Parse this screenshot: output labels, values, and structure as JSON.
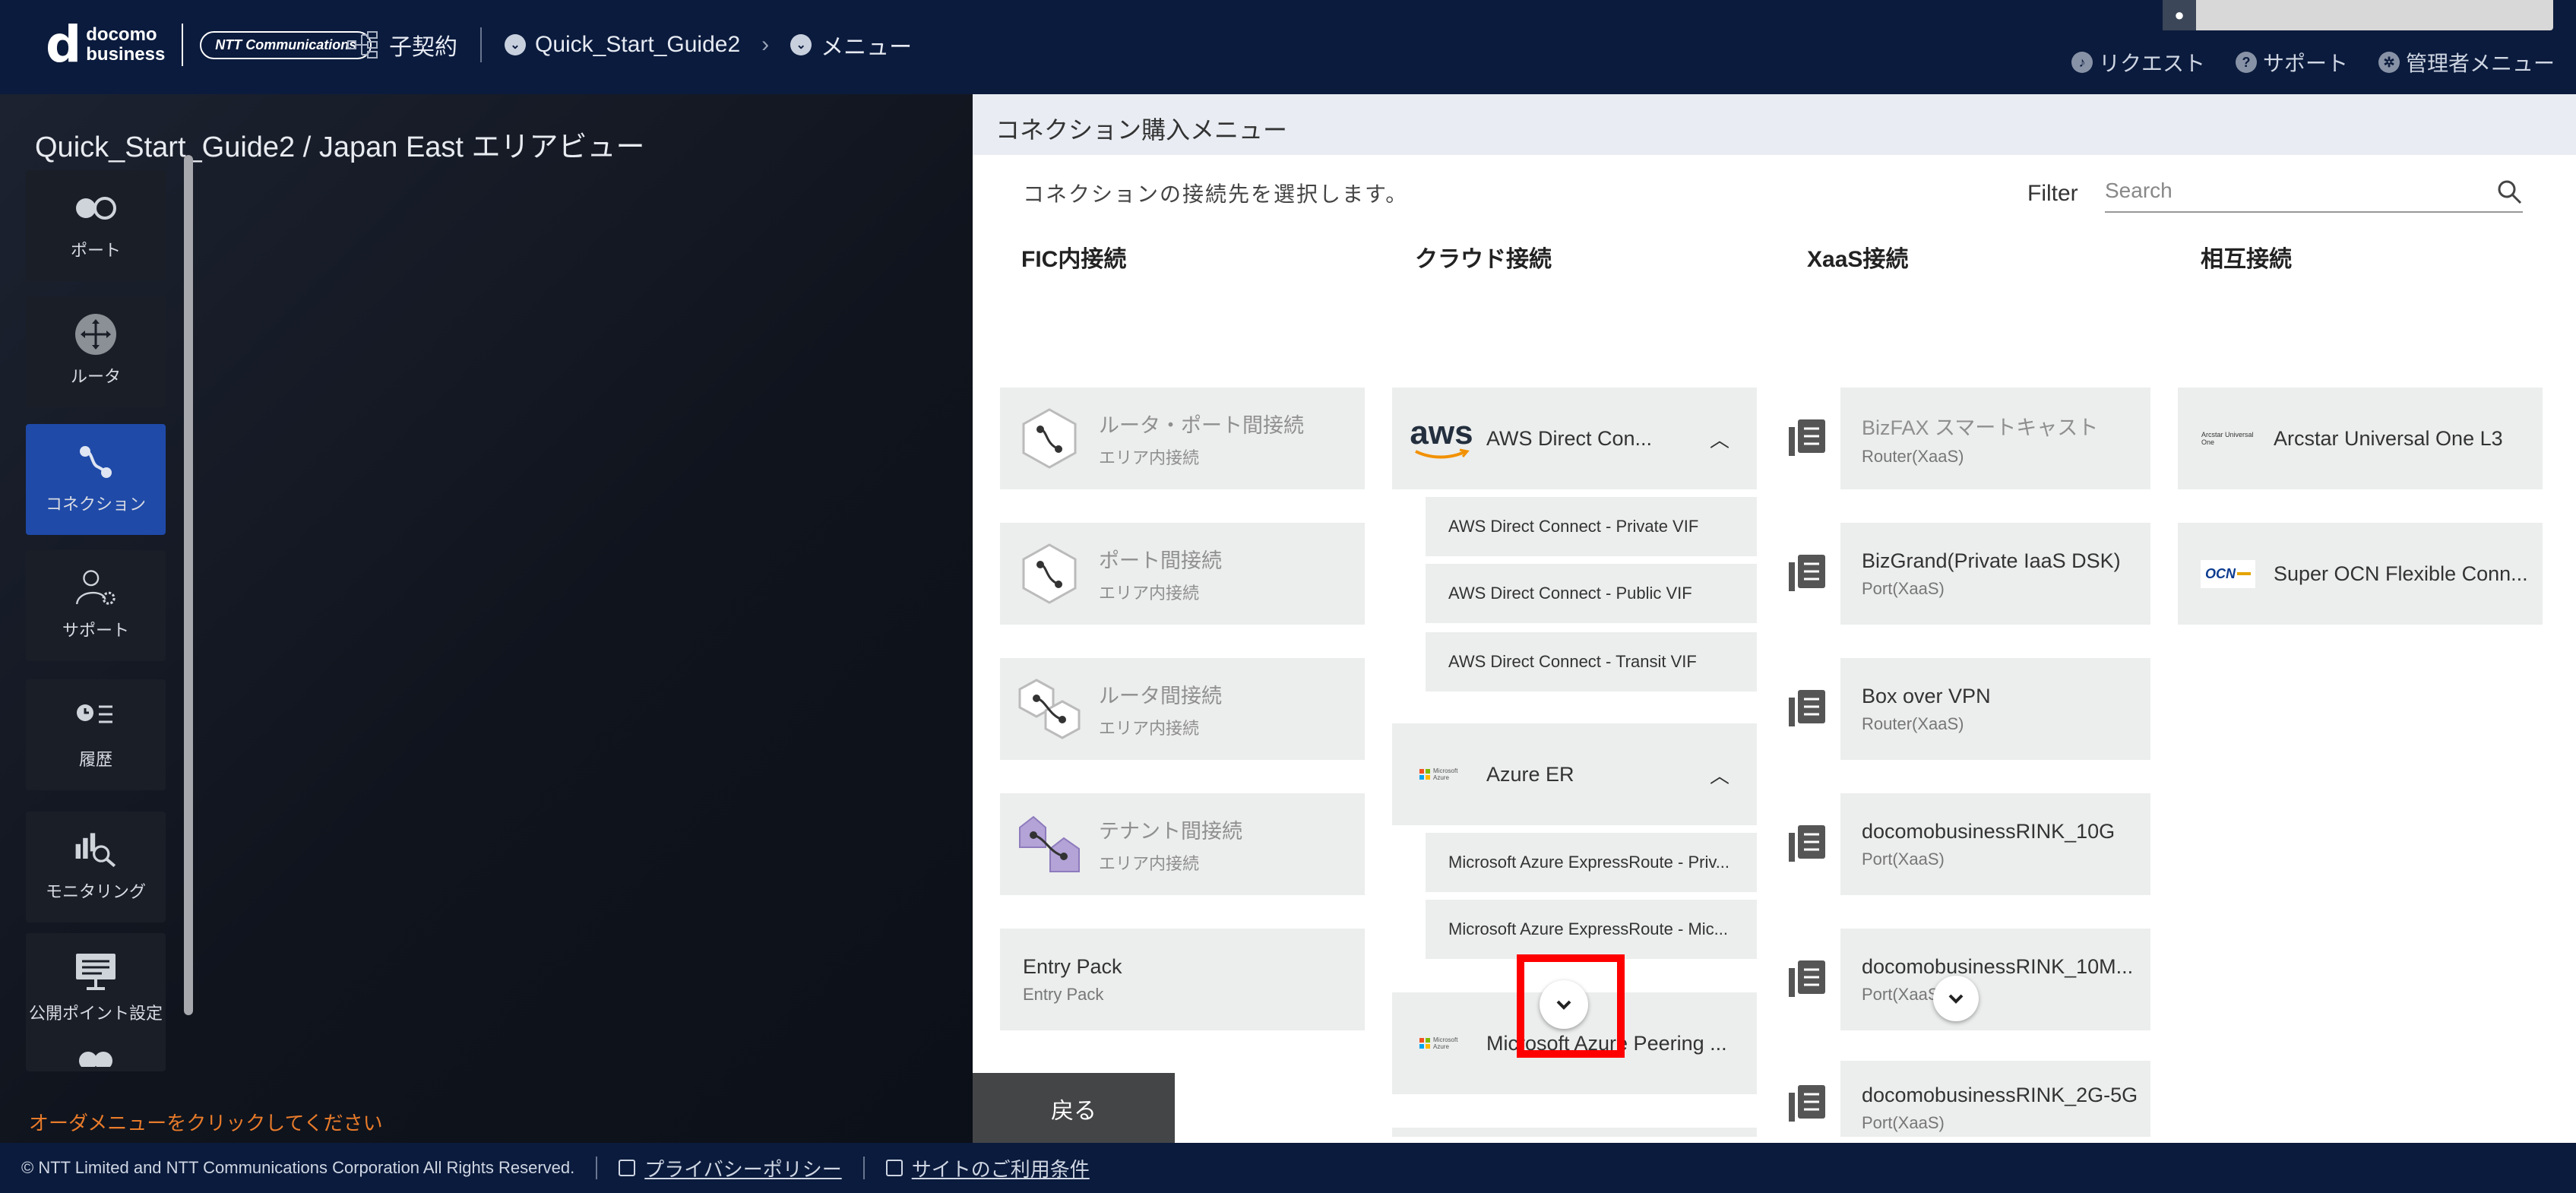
{
  "header": {
    "logo_mark": "d",
    "logo_line1": "docomo",
    "logo_line2": "business",
    "logo_partner": "NTT Communications",
    "breadcrumb": {
      "contract": "子契約",
      "project": "Quick_Start_Guide2",
      "menu": "メニュー"
    },
    "links": {
      "request": "リクエスト",
      "support": "サポート",
      "admin": "管理者メニュー"
    }
  },
  "left": {
    "area_title": "Quick_Start_Guide2 / Japan East エリアビュー",
    "sidebar": [
      {
        "label": "ポート",
        "icon": "port-icon"
      },
      {
        "label": "ルータ",
        "icon": "router-icon"
      },
      {
        "label": "コネクション",
        "icon": "connection-icon",
        "active": true
      },
      {
        "label": "サポート",
        "icon": "support-icon"
      },
      {
        "label": "履歴",
        "icon": "history-icon"
      },
      {
        "label": "モニタリング",
        "icon": "monitoring-icon"
      },
      {
        "label": "公開ポイント設定",
        "icon": "public-point-icon"
      }
    ],
    "order_message": "オーダメニューをクリックしてください"
  },
  "panel": {
    "title": "コネクション購入メニュー",
    "description": "コネクションの接続先を選択します。",
    "filter_label": "Filter",
    "search_placeholder": "Search",
    "columns": {
      "fic": {
        "title": "FIC内接続",
        "cards": [
          {
            "name": "ルータ・ポート間接続",
            "sub": "エリア内接続"
          },
          {
            "name": "ポート間接続",
            "sub": "エリア内接続"
          },
          {
            "name": "ルータ間接続",
            "sub": "エリア内接続"
          },
          {
            "name": "テナント間接続",
            "sub": "エリア内接続"
          },
          {
            "name": "Entry Pack",
            "sub": "Entry Pack"
          }
        ]
      },
      "cloud": {
        "title": "クラウド接続",
        "aws": {
          "logo": "aws",
          "name": "AWS Direct Con...",
          "options": [
            "AWS Direct Connect - Private VIF",
            "AWS Direct Connect - Public VIF",
            "AWS Direct Connect - Transit VIF"
          ]
        },
        "azure": {
          "logo": "Microsoft Azure",
          "name": "Azure ER",
          "options": [
            "Microsoft Azure ExpressRoute - Priv...",
            "Microsoft Azure ExpressRoute - Mic..."
          ]
        },
        "peering": {
          "logo": "Microsoft Azure",
          "name": "Microsoft Azure Peering ..."
        }
      },
      "xaas": {
        "title": "XaaS接続",
        "cards": [
          {
            "name": "BizFAX スマートキャスト",
            "sub": "Router(XaaS)",
            "dim": true
          },
          {
            "name": "BizGrand(Private IaaS DSK)",
            "sub": "Port(XaaS)"
          },
          {
            "name": "Box over VPN",
            "sub": "Router(XaaS)"
          },
          {
            "name": "docomobusinessRINK_10G",
            "sub": "Port(XaaS)"
          },
          {
            "name": "docomobusinessRINK_10M...",
            "sub": "Port(XaaS)"
          },
          {
            "name": "docomobusinessRINK_2G-5G",
            "sub": "Port(XaaS)"
          }
        ]
      },
      "mutual": {
        "title": "相互接続",
        "cards": [
          {
            "name": "Arcstar Universal One L3",
            "logo": "Arcstar Universal One"
          },
          {
            "name": "Super OCN Flexible Conn...",
            "logo": "OCN"
          }
        ]
      }
    },
    "back_label": "戻る"
  },
  "footer": {
    "copyright": "© NTT Limited and NTT Communications Corporation All Rights Reserved.",
    "privacy": "プライバシーポリシー",
    "terms": "サイトのご利用条件"
  }
}
